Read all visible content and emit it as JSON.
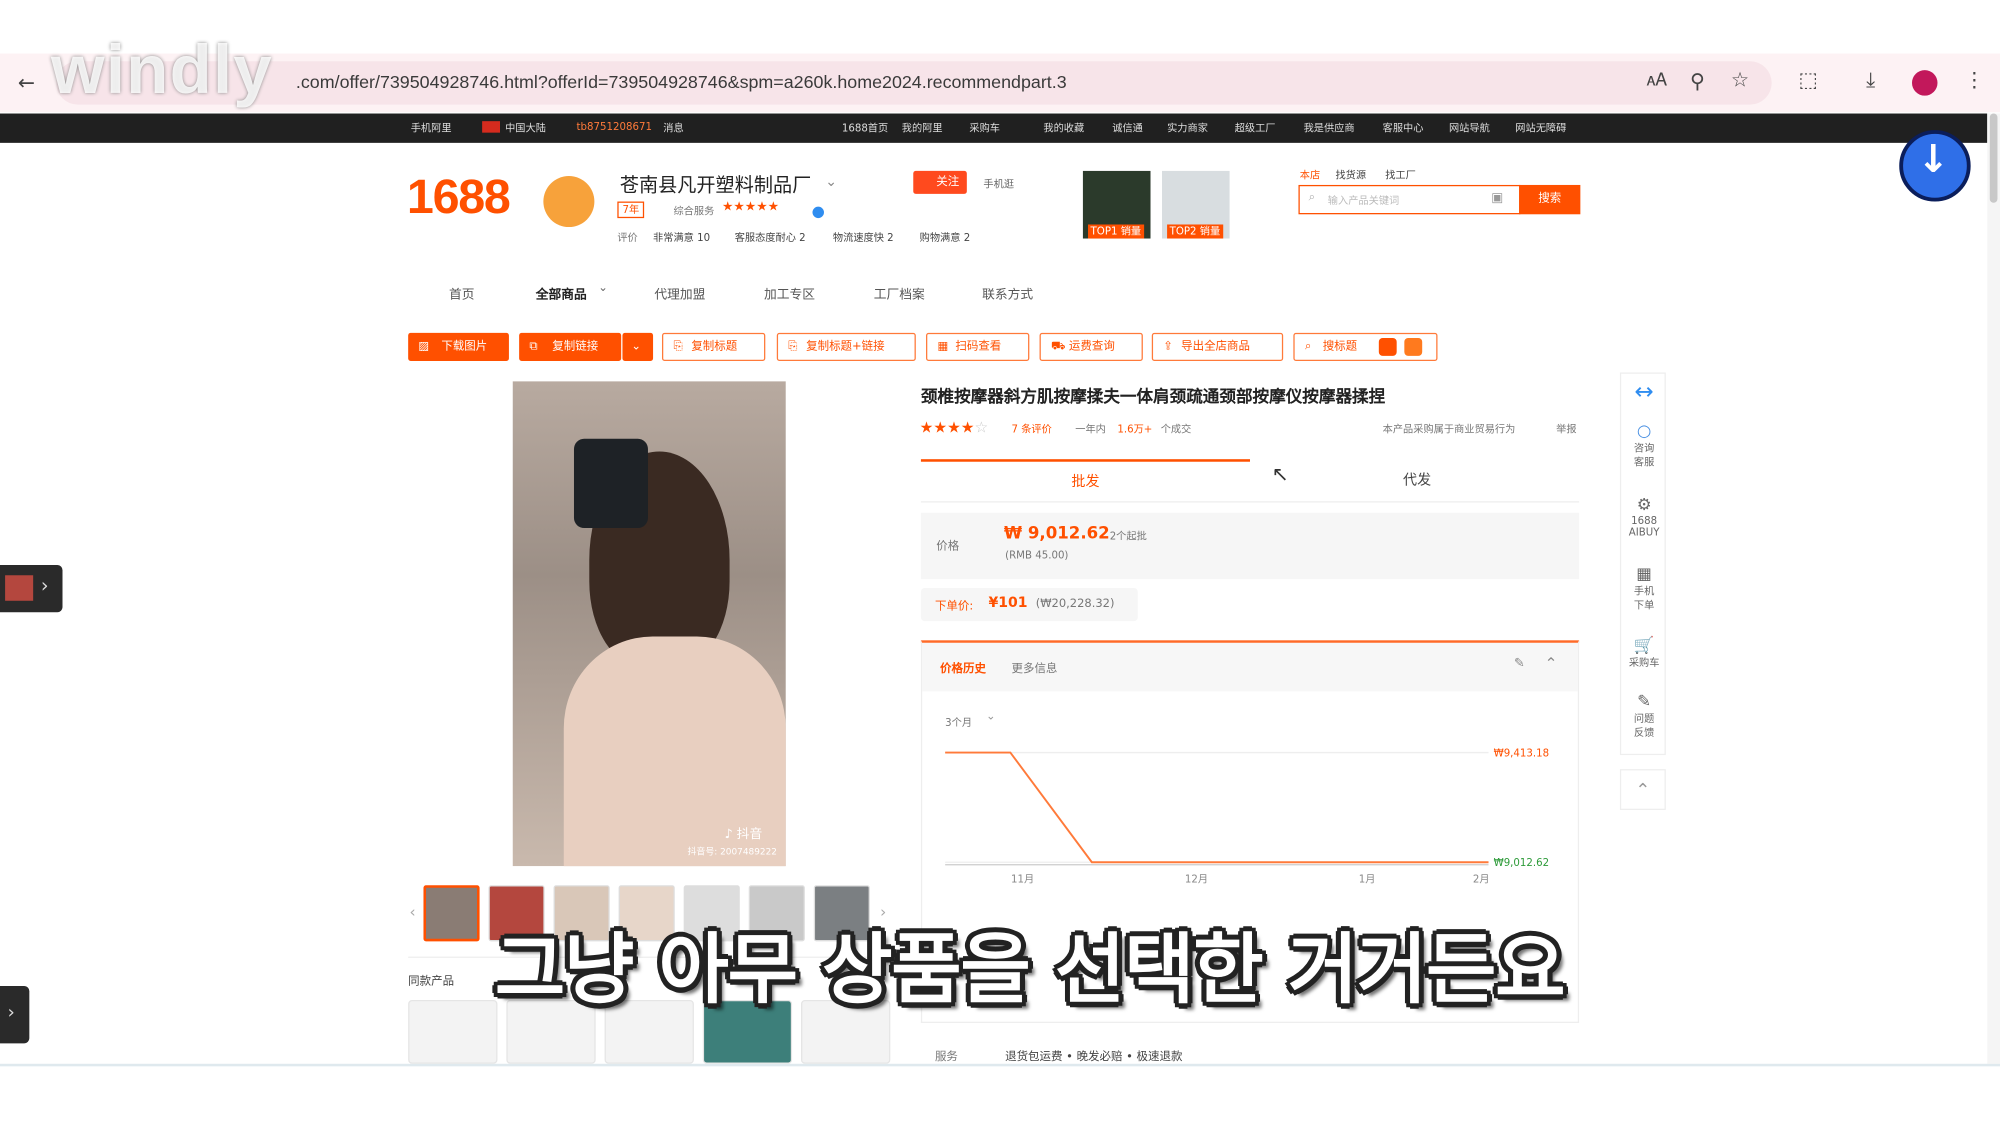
{
  "browser": {
    "url": ".com/offer/739504928746.html?offerId=739504928746&spm=a260k.home2024.recommendpart.3",
    "watermark": "windly"
  },
  "topnav": {
    "items": [
      "手机阿里",
      "中国大陆",
      "tb8751208671",
      "消息",
      "1688首页",
      "我的阿里",
      "采购车",
      "我的收藏",
      "诚信通",
      "实力商家",
      "超级工厂",
      "我是供应商",
      "客服中心",
      "网站导航",
      "网站无障碍"
    ]
  },
  "shop": {
    "logo": "1688",
    "name": "苍南县凡开塑料制品厂",
    "years": "7年",
    "rating_label": "综合服务",
    "follow": "关注",
    "mobile": "手机逛",
    "eval": "评价",
    "metrics": [
      "非常满意 10",
      "客服态度耐心 2",
      "物流速度快 2",
      "购物满意 2"
    ],
    "top1": "TOP1 销量",
    "top2": "TOP2 销量",
    "search_tabs": [
      "本店",
      "找货源",
      "找工厂"
    ],
    "search_placeholder": "输入产品关键词",
    "search_button": "搜索"
  },
  "shopnav": [
    "首页",
    "全部商品",
    "代理加盟",
    "加工专区",
    "工厂档案",
    "联系方式"
  ],
  "toolbar": {
    "download_images": "下载图片",
    "copy_link": "复制链接",
    "copy_title": "复制标题",
    "copy_title_link": "复制标题+链接",
    "scan_code": "扫码查看",
    "shipping": "运费查询",
    "export_all": "导出全店商品",
    "search_title": "搜标题"
  },
  "product": {
    "title": "颈椎按摩器斜方肌按摩揉夫一体肩颈疏通颈部按摩仪按摩器揉捏",
    "rating": 3.5,
    "reviews": "7 条评价",
    "sold_prefix": "一年内",
    "sold": "1.6万+",
    "sold_suffix": "个成交",
    "notice": "本产品采购属于商业贸易行为",
    "report": "举报",
    "tabs": [
      "批发",
      "代发"
    ],
    "price_label": "价格",
    "price": "₩ 9,012.62",
    "min_order": "2个起批",
    "price_rmb": "(RMB 45.00)",
    "unit_price_label": "下单价:",
    "unit_price": "¥101",
    "unit_price_krw": "(₩20,228.32)",
    "douyin": "抖音",
    "douyin_id": "抖音号: 2007489222",
    "related_label": "同款产品",
    "service_label": "服务",
    "service": "退货包运费 • 晚发必赔 • 极速退款"
  },
  "price_history": {
    "tab_active": "价格历史",
    "tab_more": "更多信息",
    "range": "3个月",
    "high_label": "₩9,413.18",
    "low_label": "₩9,012.62"
  },
  "chart_data": {
    "type": "line",
    "x": [
      "11月",
      "12月",
      "1月",
      "2月"
    ],
    "series": [
      {
        "values": [
          9413.18,
          9012.62,
          9012.62,
          9012.62
        ]
      }
    ],
    "points": [
      {
        "x": "10月末",
        "y": 9413.18
      },
      {
        "x": "11月初",
        "y": 9413.18
      },
      {
        "x": "11月下旬",
        "y": 9012.62
      },
      {
        "x": "2月",
        "y": 9012.62
      }
    ],
    "ylim": [
      9012.62,
      9413.18
    ]
  },
  "sidebar": [
    {
      "label": "咨询客服"
    },
    {
      "label": "1688 AIBUY"
    },
    {
      "label": "手机下单"
    },
    {
      "label": "采购车"
    },
    {
      "label": "问题反馈"
    }
  ],
  "subtitle": "그냥 아무 상품을 선택한 거거든요",
  "colors": {
    "brand": "#ff5000",
    "accent_blue": "#2f6fe8",
    "nav_dark": "#202020"
  }
}
